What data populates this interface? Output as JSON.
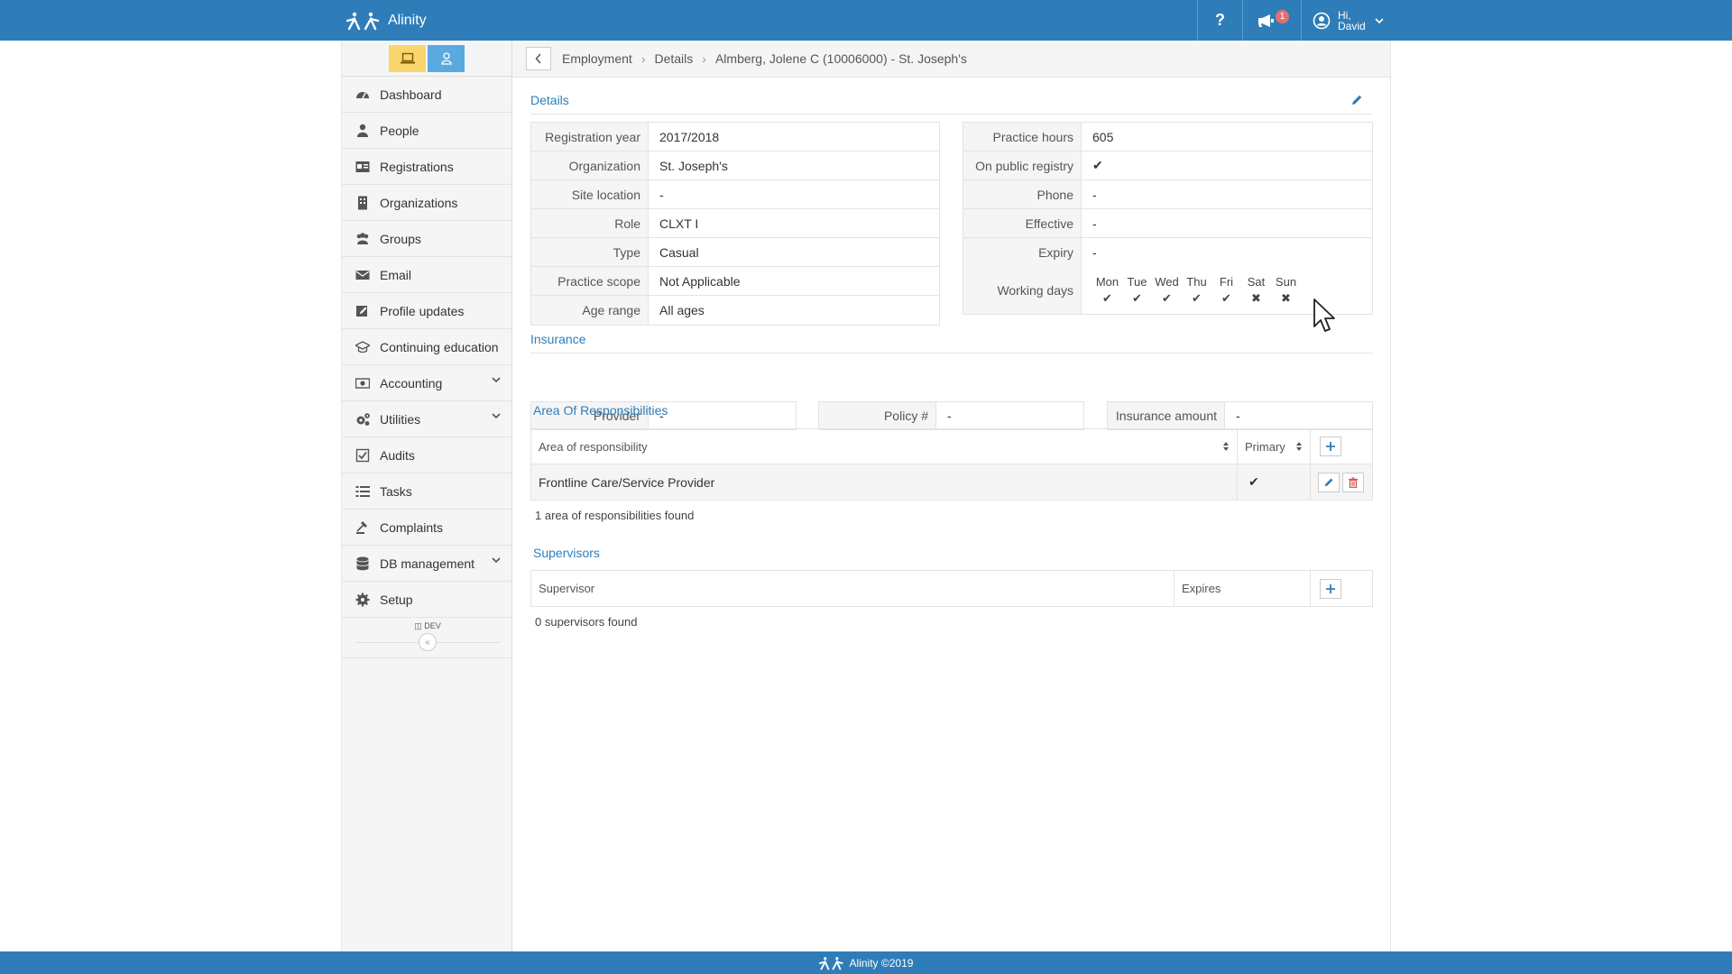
{
  "app": {
    "name": "Alinity",
    "user_greeting": "Hi,",
    "user_name": "David",
    "notification_count": "1",
    "help_label": "?"
  },
  "sidebar": {
    "items": [
      {
        "label": "Dashboard",
        "icon": "dashboard-icon"
      },
      {
        "label": "People",
        "icon": "person-icon"
      },
      {
        "label": "Registrations",
        "icon": "id-card-icon"
      },
      {
        "label": "Organizations",
        "icon": "building-icon"
      },
      {
        "label": "Groups",
        "icon": "users-icon"
      },
      {
        "label": "Email",
        "icon": "envelope-icon"
      },
      {
        "label": "Profile updates",
        "icon": "edit-icon"
      },
      {
        "label": "Continuing education",
        "icon": "graduation-cap-icon"
      },
      {
        "label": "Accounting",
        "icon": "money-icon",
        "expandable": true
      },
      {
        "label": "Utilities",
        "icon": "gears-icon",
        "expandable": true
      },
      {
        "label": "Audits",
        "icon": "checkbox-icon"
      },
      {
        "label": "Tasks",
        "icon": "tasks-icon"
      },
      {
        "label": "Complaints",
        "icon": "gavel-icon"
      },
      {
        "label": "DB management",
        "icon": "database-icon",
        "expandable": true
      },
      {
        "label": "Setup",
        "icon": "gear-icon"
      }
    ],
    "env_label": "DEV",
    "collapse_label": "«"
  },
  "breadcrumb": [
    "Employment",
    "Details",
    "Almberg, Jolene C (10006000) - St. Joseph's"
  ],
  "details": {
    "title": "Details",
    "left": [
      {
        "label": "Registration year",
        "value": "2017/2018"
      },
      {
        "label": "Organization",
        "value": "St. Joseph's"
      },
      {
        "label": "Site location",
        "value": "-"
      },
      {
        "label": "Role",
        "value": "CLXT I"
      },
      {
        "label": "Type",
        "value": "Casual"
      },
      {
        "label": "Practice scope",
        "value": "Not Applicable"
      },
      {
        "label": "Age range",
        "value": "All ages"
      }
    ],
    "right": [
      {
        "label": "Practice hours",
        "value": "605"
      },
      {
        "label": "On public registry",
        "value": "✔"
      },
      {
        "label": "Phone",
        "value": "-"
      },
      {
        "label": "Effective",
        "value": "-"
      },
      {
        "label": "Expiry",
        "value": "-"
      }
    ],
    "working_days_label": "Working days",
    "working_days": [
      {
        "day": "Mon",
        "mark": "✔"
      },
      {
        "day": "Tue",
        "mark": "✔"
      },
      {
        "day": "Wed",
        "mark": "✔"
      },
      {
        "day": "Thu",
        "mark": "✔"
      },
      {
        "day": "Fri",
        "mark": "✔"
      },
      {
        "day": "Sat",
        "mark": "✖"
      },
      {
        "day": "Sun",
        "mark": "✖"
      }
    ]
  },
  "insurance": {
    "title": "Insurance",
    "provider_label": "Provider",
    "provider_value": "-",
    "policy_label": "Policy #",
    "policy_value": "-",
    "amount_label": "Insurance amount",
    "amount_value": "-"
  },
  "responsibilities": {
    "title": "Area Of Responsibilities",
    "col_area": "Area of responsibility",
    "col_primary": "Primary",
    "rows": [
      {
        "area": "Frontline Care/Service Provider",
        "primary": "✔"
      }
    ],
    "found_text": "1 area of responsibilities found"
  },
  "supervisors": {
    "title": "Supervisors",
    "col_supervisor": "Supervisor",
    "col_expires": "Expires",
    "found_text": "0 supervisors found"
  },
  "footer": {
    "text": "Alinity ©2019"
  },
  "colors": {
    "brand": "#2e7db9",
    "sidebar_yellow": "#f8d66d",
    "sidebar_blue": "#5aaae0",
    "danger": "#d9534f"
  }
}
